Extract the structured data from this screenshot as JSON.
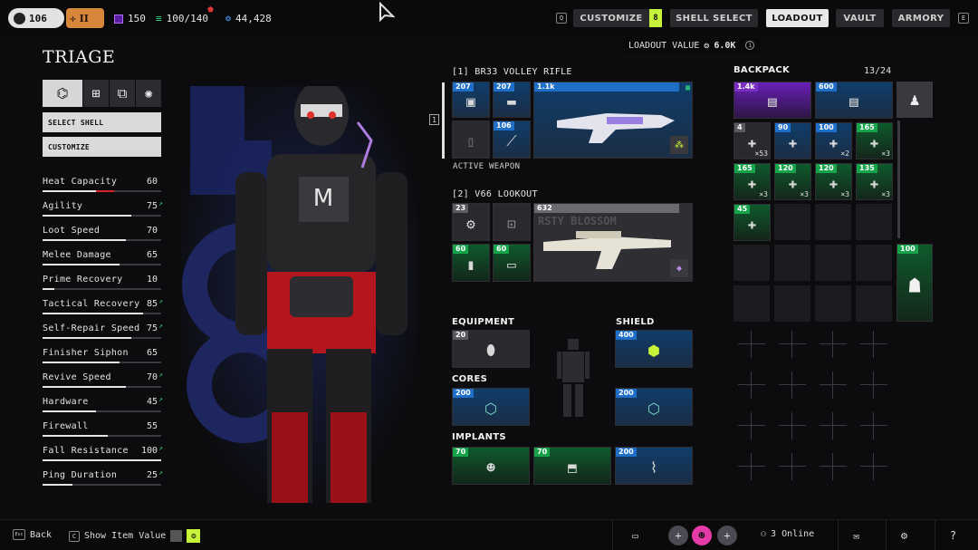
{
  "topbar": {
    "level": "106",
    "rank": "II",
    "currency1": "150",
    "capacity": "100/140",
    "credits": "44,428",
    "nav": [
      "CUSTOMIZE",
      "SHELL SELECT",
      "LOADOUT",
      "VAULT",
      "ARMORY"
    ],
    "customize_badge": "8",
    "left_key": "Q",
    "right_key": "E",
    "loadout_value_label": "LOADOUT VALUE",
    "loadout_value": "6.0K"
  },
  "left": {
    "shell_name": "TRIAGE",
    "select_shell": "SELECT SHELL",
    "customize": "CUSTOMIZE",
    "stats": [
      {
        "name": "Heat Capacity",
        "value": "60",
        "fill": 0.6,
        "up": false
      },
      {
        "name": "Agility",
        "value": "75",
        "fill": 0.75,
        "up": true
      },
      {
        "name": "Loot Speed",
        "value": "70",
        "fill": 0.7,
        "up": false
      },
      {
        "name": "Melee Damage",
        "value": "65",
        "fill": 0.65,
        "up": false
      },
      {
        "name": "Prime Recovery",
        "value": "10",
        "fill": 0.1,
        "up": false
      },
      {
        "name": "Tactical Recovery",
        "value": "85",
        "fill": 0.85,
        "up": true
      },
      {
        "name": "Self-Repair Speed",
        "value": "75",
        "fill": 0.75,
        "up": true
      },
      {
        "name": "Finisher Siphon",
        "value": "65",
        "fill": 0.65,
        "up": false
      },
      {
        "name": "Revive Speed",
        "value": "70",
        "fill": 0.7,
        "up": true
      },
      {
        "name": "Hardware",
        "value": "45",
        "fill": 0.45,
        "up": true
      },
      {
        "name": "Firewall",
        "value": "55",
        "fill": 0.55,
        "up": false
      },
      {
        "name": "Fall Resistance",
        "value": "100",
        "fill": 1.0,
        "up": true
      },
      {
        "name": "Ping Duration",
        "value": "25",
        "fill": 0.25,
        "up": true
      }
    ]
  },
  "weapons": {
    "w1_title": "[1] BR33 VOLLEY RIFLE",
    "w1_slot_a": "207",
    "w1_slot_b": "207",
    "w1_slot_c": "106",
    "w1_main": "1.1k",
    "active_label": "ACTIVE WEAPON",
    "slot_number": "1",
    "w2_title": "[2] V66 LOOKOUT",
    "w2_slot_a": "23",
    "w2_slot_c": "60",
    "w2_slot_d": "60",
    "w2_main": "632",
    "w2_bg_text": "RSTY BLOSSOM"
  },
  "gear": {
    "equipment_label": "EQUIPMENT",
    "equipment_value": "20",
    "shield_label": "SHIELD",
    "shield_value": "400",
    "cores_label": "CORES",
    "core1_value": "200",
    "core2_value": "200",
    "implants_label": "IMPLANTS",
    "implant1_value": "70",
    "implant2_value": "70",
    "implant3_value": "200"
  },
  "backpack": {
    "label": "BACKPACK",
    "count": "13/24",
    "items": [
      {
        "value": "1.4k",
        "tier": "purple",
        "qty": ""
      },
      {
        "value": "600",
        "tier": "blue",
        "qty": ""
      },
      {
        "value": "4",
        "tier": "gray",
        "qty": "×53"
      },
      {
        "value": "90",
        "tier": "blue",
        "qty": ""
      },
      {
        "value": "100",
        "tier": "blue",
        "qty": "×2"
      },
      {
        "value": "165",
        "tier": "green",
        "qty": "×3"
      },
      {
        "value": "165",
        "tier": "green",
        "qty": "×3"
      },
      {
        "value": "120",
        "tier": "green",
        "qty": "×3"
      },
      {
        "value": "120",
        "tier": "green",
        "qty": "×3"
      },
      {
        "value": "135",
        "tier": "green",
        "qty": "×3"
      },
      {
        "value": "45",
        "tier": "green",
        "qty": ""
      }
    ],
    "side_value": "100"
  },
  "bottombar": {
    "back": "Back",
    "show_value": "Show Item Value",
    "online": "3 Online",
    "back_key": "Esc",
    "show_key": "C",
    "help": "?"
  },
  "colors": {
    "blue": "#1f6fc9",
    "green": "#16a34a",
    "purple": "#7a2fc0",
    "accent_yellow": "#c6f43a",
    "heat_red": "#d8232a"
  }
}
